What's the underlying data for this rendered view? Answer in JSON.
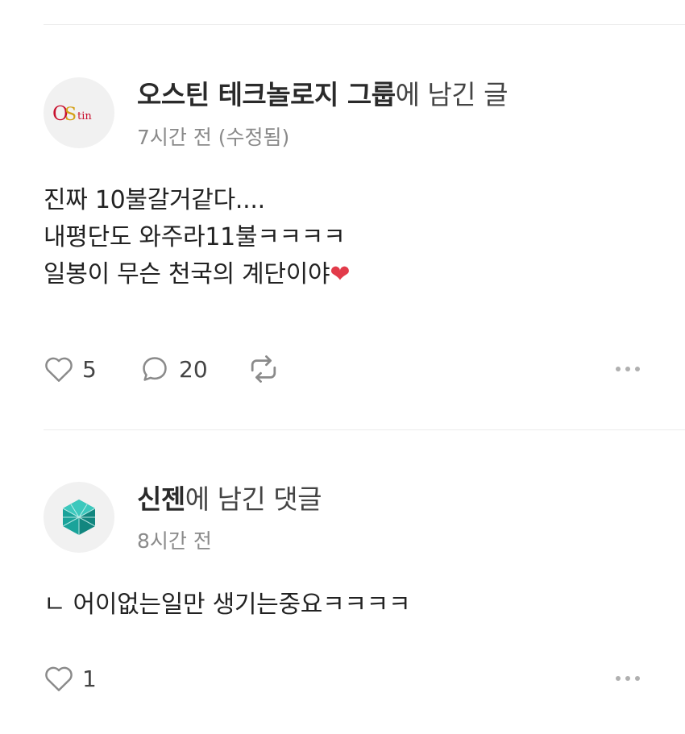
{
  "posts": [
    {
      "avatar_text_o": "O",
      "avatar_text_s": "S",
      "avatar_text_tin": "tin",
      "title_bold": "오스틴 테크놀로지 그룹",
      "title_rest": "에 남긴 글",
      "meta": "7시간 전 (수정됨)",
      "lines": [
        "진짜 10불갈거같다....",
        "내평단도 와주라11불ㅋㅋㅋㅋ",
        "일봉이 무슨 천국의 계단이야"
      ],
      "line3_emoji": "❤",
      "likes": "5",
      "comments": "20"
    },
    {
      "title_bold": "신젠",
      "title_rest": "에 남긴 댓글",
      "meta": "8시간 전",
      "lines": [
        "ㄴ 어이없는일만 생기는중요ㅋㅋㅋㅋ"
      ],
      "likes": "1"
    }
  ],
  "colors": {
    "accent_heart": "#e23b4a",
    "logo_red": "#c8102e",
    "logo_gold": "#d4a017",
    "logo_teal": "#1aa39a"
  },
  "icons": [
    "heart-outline-icon",
    "comment-bubble-icon",
    "repost-icon",
    "more-dots-icon"
  ]
}
